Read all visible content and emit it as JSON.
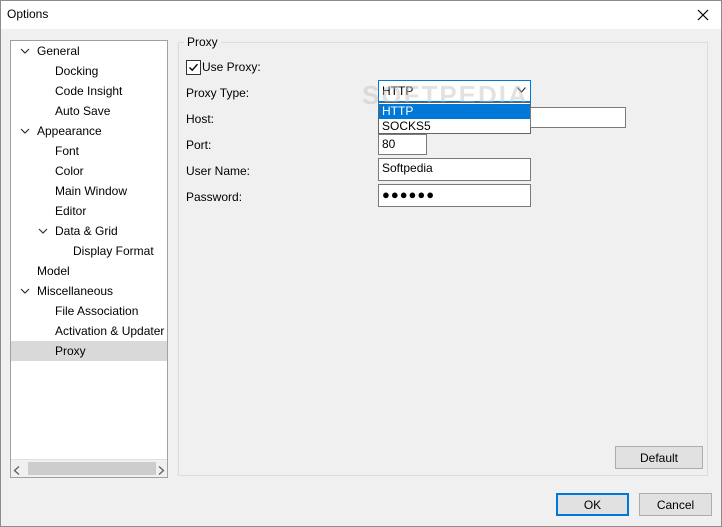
{
  "window": {
    "title": "Options",
    "close_glyph": "✕"
  },
  "tree": {
    "items": [
      {
        "label": "General",
        "level": 0,
        "expanded": true
      },
      {
        "label": "Docking",
        "level": 1
      },
      {
        "label": "Code Insight",
        "level": 1
      },
      {
        "label": "Auto Save",
        "level": 1
      },
      {
        "label": "Appearance",
        "level": 0,
        "expanded": true
      },
      {
        "label": "Font",
        "level": 1
      },
      {
        "label": "Color",
        "level": 1
      },
      {
        "label": "Main Window",
        "level": 1
      },
      {
        "label": "Editor",
        "level": 1
      },
      {
        "label": "Data & Grid",
        "level": 1,
        "expanded": true
      },
      {
        "label": "Display Format",
        "level": 2
      },
      {
        "label": "Model",
        "level": 0
      },
      {
        "label": "Miscellaneous",
        "level": 0,
        "expanded": true
      },
      {
        "label": "File Association",
        "level": 1
      },
      {
        "label": "Activation & Updater",
        "level": 1
      },
      {
        "label": "Proxy",
        "level": 1,
        "selected": true
      }
    ],
    "scroll_left_glyph": "<",
    "scroll_right_glyph": ">"
  },
  "proxy": {
    "group_title": "Proxy",
    "use_proxy_label": "Use Proxy:",
    "use_proxy_checked": true,
    "proxy_type_label": "Proxy Type:",
    "proxy_type_value": "HTTP",
    "proxy_type_options": [
      "HTTP",
      "SOCKS5"
    ],
    "host_label": "Host:",
    "host_value": "",
    "port_label": "Port:",
    "port_value": "80",
    "username_label": "User Name:",
    "username_value": "Softpedia",
    "password_label": "Password:",
    "password_value": "●●●●●●"
  },
  "watermark": "SOFTPEDIA",
  "buttons": {
    "default": "Default",
    "ok": "OK",
    "cancel": "Cancel"
  },
  "colors": {
    "accent": "#0078d7",
    "selection_bg": "#d9d9d9"
  }
}
